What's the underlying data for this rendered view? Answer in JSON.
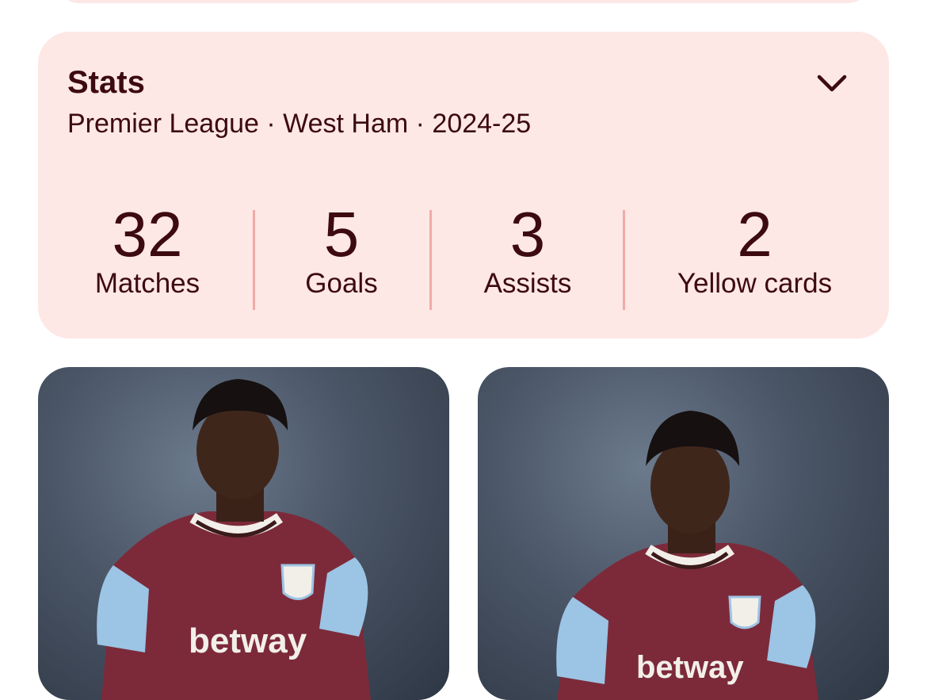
{
  "stats_card": {
    "title": "Stats",
    "subtitle": "Premier League · West Ham · 2024-25",
    "expand_icon": "chevron-down-icon",
    "items": [
      {
        "value": "32",
        "label": "Matches"
      },
      {
        "value": "5",
        "label": "Goals"
      },
      {
        "value": "3",
        "label": "Assists"
      },
      {
        "value": "2",
        "label": "Yellow cards"
      }
    ]
  },
  "images": {
    "sponsor_text": "betway"
  },
  "colors": {
    "card_bg": "#fde8e6",
    "text": "#3d0a0f",
    "divider": "#f1aaa6",
    "claret": "#7c2a3a",
    "sky_blue": "#9cc4e4"
  }
}
